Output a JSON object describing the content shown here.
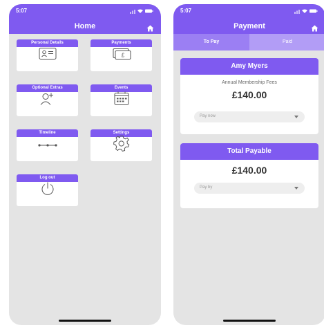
{
  "status": {
    "time": "5:07"
  },
  "home": {
    "title": "Home",
    "tiles": [
      {
        "label": "Personal Details",
        "icon": "id-card-icon"
      },
      {
        "label": "Payments",
        "icon": "banknote-icon"
      },
      {
        "label": "Optional Extras",
        "icon": "add-user-icon"
      },
      {
        "label": "Events",
        "icon": "calendar-icon"
      },
      {
        "label": "Timeline",
        "icon": "timeline-icon"
      },
      {
        "label": "Settings",
        "icon": "gear-icon"
      },
      {
        "label": "Log out",
        "icon": "power-icon"
      }
    ]
  },
  "payment": {
    "title": "Payment",
    "tabs": [
      {
        "label": "To Pay"
      },
      {
        "label": "Paid"
      }
    ],
    "member_card": {
      "name": "Amy Myers",
      "description": "Annual Membership Fees",
      "amount": "£140.00",
      "select_value": "Pay now"
    },
    "total_card": {
      "title": "Total Payable",
      "amount": "£140.00",
      "select_value": "Pay by"
    }
  },
  "colors": {
    "accent": "#7f5af0",
    "tab_bar": "#b29df6",
    "background": "#e4e4e4"
  }
}
